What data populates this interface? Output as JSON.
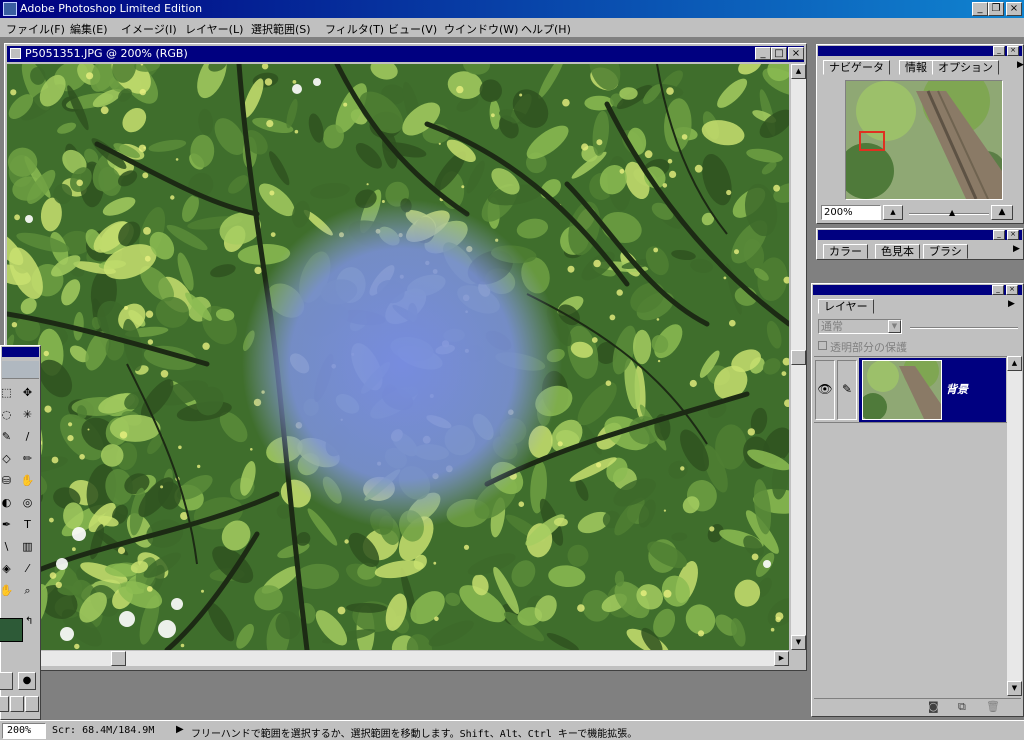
{
  "app": {
    "title": "Adobe Photoshop Limited Edition",
    "window_buttons": [
      "_",
      "❐",
      "×"
    ]
  },
  "menu": [
    "ファイル(F)",
    "編集(E)",
    "イメージ(I)",
    "レイヤー(L)",
    "選択範囲(S)",
    "フィルタ(T)",
    "ビュー(V)",
    "ウインドウ(W)",
    "ヘルプ(H)"
  ],
  "document": {
    "title": "P5051351.JPG @ 200% (RGB)",
    "buttons": [
      "_",
      "□",
      "×"
    ]
  },
  "toolbox": {
    "tools": [
      "marquee-tool",
      "move-tool",
      "lasso-tool",
      "magic-wand-tool",
      "airbrush-tool",
      "paintbrush-tool",
      "eraser-tool",
      "pencil-tool",
      "rubber-stamp-tool",
      "smudge-tool",
      "dodge-tool",
      "sponge-tool",
      "pen-tool",
      "type-tool",
      "line-tool",
      "gradient-tool",
      "paint-bucket-tool",
      "eyedropper-tool",
      "hand-tool",
      "zoom-tool"
    ],
    "foreground_color": "#2d5a37",
    "background_color": "#ffffff"
  },
  "navigator": {
    "tabs": [
      "ナビゲータ",
      "情報",
      "オプション"
    ],
    "zoom": "200%"
  },
  "color_panel": {
    "tabs": [
      "カラー",
      "色見本",
      "ブラシ"
    ]
  },
  "layers": {
    "tab": "レイヤー",
    "blend_mode": "通常",
    "preserve_transparency": "透明部分の保護",
    "layer_name": "背景"
  },
  "status": {
    "zoom": "200%",
    "scratch": "Scr: 68.4M/184.9M",
    "message": "フリーハンドで範囲を選択するか、選択範囲を移動します。Shift、Alt、Ctrl キーで機能拡張。"
  },
  "colors": {
    "title_blue": "#000080",
    "face": "#c0c0c0",
    "selection_blue": "#7d8ee0",
    "foliage": "#4a7a32"
  }
}
